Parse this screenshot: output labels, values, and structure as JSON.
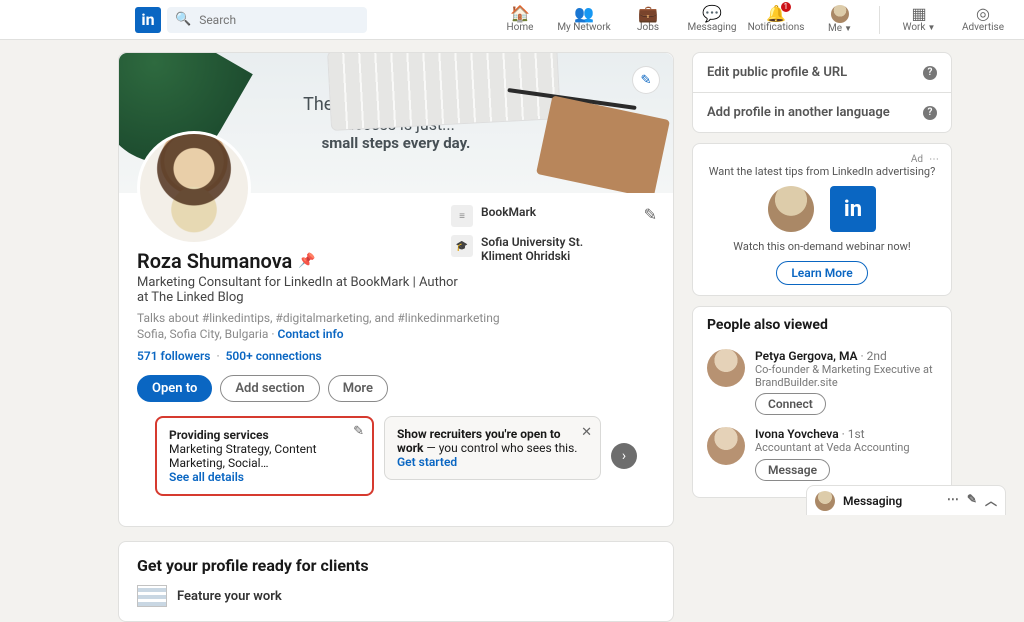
{
  "nav": {
    "search_placeholder": "Search",
    "items": [
      {
        "label": "Home",
        "icon": "🏠"
      },
      {
        "label": "My Network",
        "icon": "👥"
      },
      {
        "label": "Jobs",
        "icon": "💼"
      },
      {
        "label": "Messaging",
        "icon": "💬"
      },
      {
        "label": "Notifications",
        "icon": "🔔",
        "badge": "1"
      },
      {
        "label": "Me",
        "icon": "avatar",
        "caret": true
      }
    ],
    "work_label": "Work",
    "advertise_label": "Advertise"
  },
  "banner": {
    "line1": "The secret to long term",
    "line2": "success is just...",
    "line3": "small steps every day."
  },
  "profile": {
    "name": "Roza Shumanova",
    "name_emoji": "📌",
    "headline": "Marketing Consultant for LinkedIn at BookMark | Author at The Linked Blog",
    "talks": "Talks about #linkedintips, #digitalmarketing, and #linkedinmarketing",
    "location": "Sofia, Sofia City, Bulgaria",
    "contact_label": "Contact info",
    "followers": "571 followers",
    "connections": "500+ connections",
    "buttons": {
      "open": "Open to",
      "add": "Add section",
      "more": "More"
    },
    "affiliations": [
      {
        "name": "BookMark"
      },
      {
        "name": "Sofia University St. Kliment Ohridski"
      }
    ]
  },
  "open_cards": {
    "services": {
      "title": "Providing services",
      "text": "Marketing Strategy, Content Marketing, Social…",
      "link": "See all details"
    },
    "recruiters": {
      "title": "Show recruiters you're open to work",
      "tail": " — you control who sees this.",
      "link": "Get started"
    }
  },
  "ready": {
    "heading": "Get your profile ready for clients",
    "item1": "Feature your work"
  },
  "side": {
    "edit_url": "Edit public profile & URL",
    "add_lang": "Add profile in another language",
    "ad": {
      "label": "Ad",
      "tag": "Want the latest tips from LinkedIn advertising?",
      "cta_line": "Watch this on-demand webinar now!",
      "button": "Learn More"
    },
    "pav_heading": "People also viewed",
    "people": [
      {
        "name": "Petya Gergova, MA",
        "degree": " · 2nd",
        "sub": "Co-founder & Marketing Executive at BrandBuilder.site",
        "action": "Connect"
      },
      {
        "name": "Ivona Yovcheva",
        "degree": " · 1st",
        "sub": "Accountant at Veda Accounting",
        "action": "Message"
      }
    ]
  },
  "tray": {
    "label": "Messaging"
  }
}
